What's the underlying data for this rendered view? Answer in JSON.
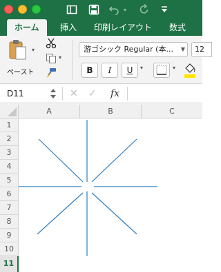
{
  "ribbon_tabs": [
    "ホーム",
    "挿入",
    "印刷レイアウト",
    "数式"
  ],
  "clipboard": {
    "paste_label": "ペースト"
  },
  "font": {
    "name": "游ゴシック Regular (本...",
    "size": "12"
  },
  "format_buttons": [
    "B",
    "I",
    "U"
  ],
  "formula_bar": {
    "name_box": "D11",
    "fx": "fx",
    "value": ""
  },
  "columns": [
    "A",
    "B",
    "C"
  ],
  "rows": [
    "1",
    "2",
    "3",
    "4",
    "5",
    "6",
    "7",
    "8",
    "9",
    "10",
    "11"
  ],
  "selected_cell": "D11",
  "colors": {
    "brand": "#1e7145",
    "line": "#2e7ebf"
  }
}
